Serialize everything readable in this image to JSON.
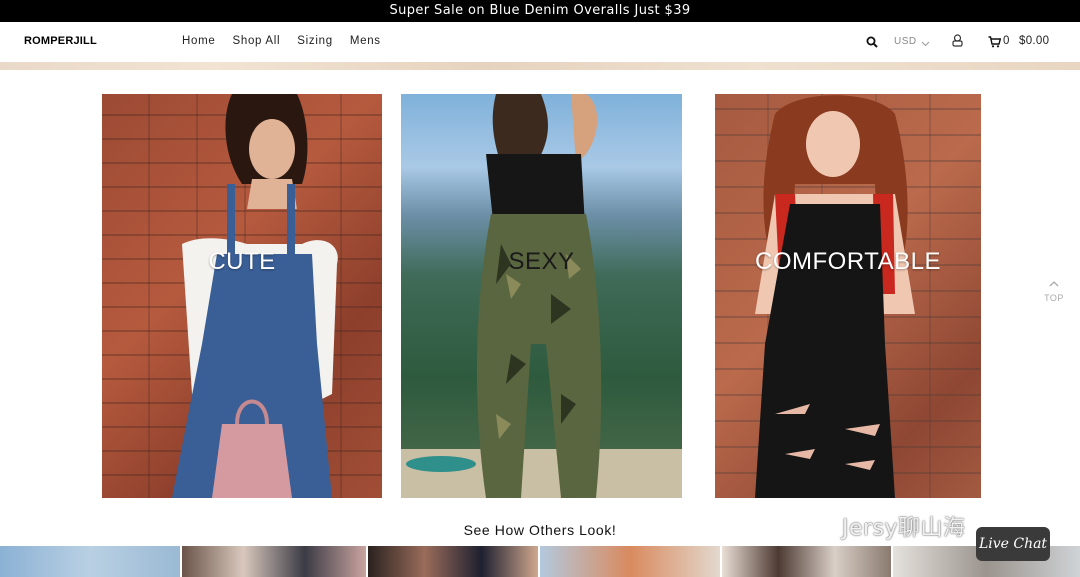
{
  "announcement": "Super Sale on Blue Denim Overalls Just $39",
  "header": {
    "logo": "ROMPERJILL",
    "nav": [
      "Home",
      "Shop All",
      "Sizing",
      "Mens"
    ],
    "currency": "USD",
    "cart_count": "0",
    "cart_total": "$0.00"
  },
  "cards": [
    {
      "label": "CUTE"
    },
    {
      "label": "SEXY"
    },
    {
      "label": "COMFORTABLE"
    }
  ],
  "back_to_top": "TOP",
  "gallery_heading": "See How Others Look!",
  "watermark": "Jersy聊山海",
  "live_chat": "Live Chat",
  "colors": {
    "announcement_bg": "#000000",
    "strip": "#ead9c8",
    "brick": "#a14e36"
  }
}
